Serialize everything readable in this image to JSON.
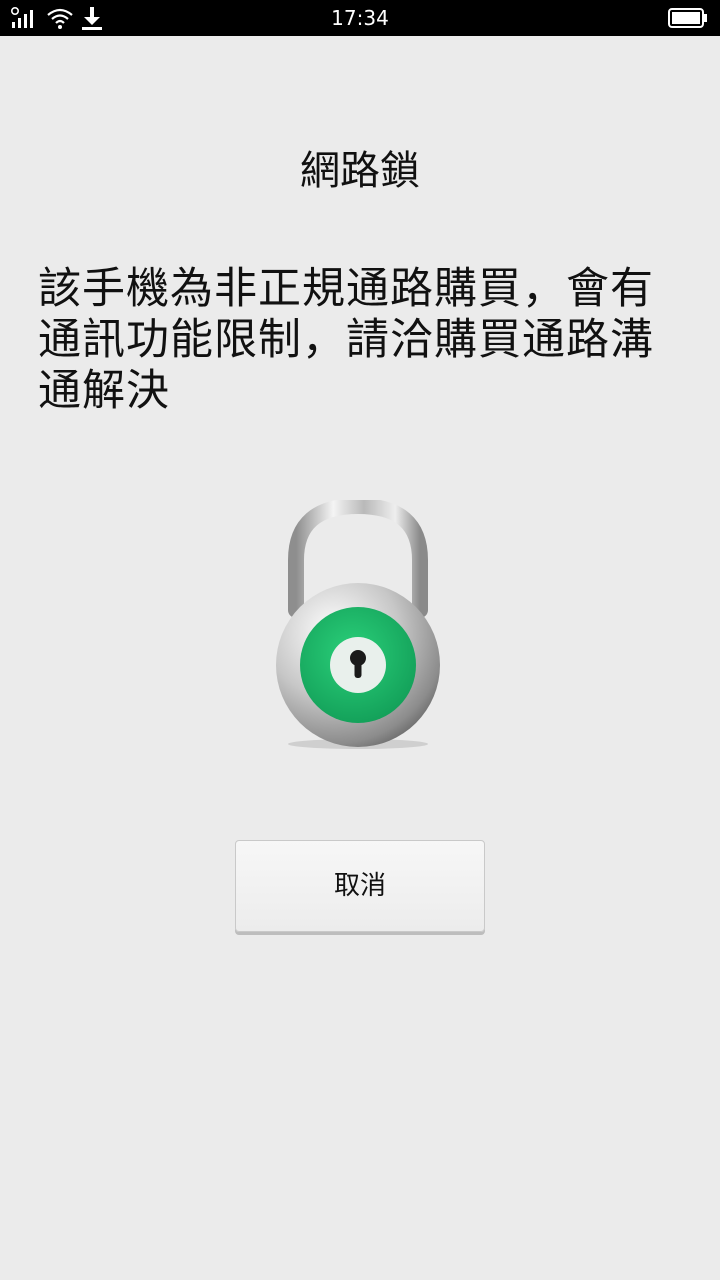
{
  "status_bar": {
    "time": "17:34",
    "icons": [
      "signal-icon",
      "wifi-icon",
      "download-icon",
      "battery-icon"
    ]
  },
  "dialog": {
    "title": "網路鎖",
    "message": "該手機為非正規通路購買，會有通訊功能限制，請洽購買通路溝通解決",
    "cancel_label": "取消"
  },
  "colors": {
    "background": "#ebebeb",
    "status_bar": "#000000",
    "lock_green": "#1db565"
  }
}
